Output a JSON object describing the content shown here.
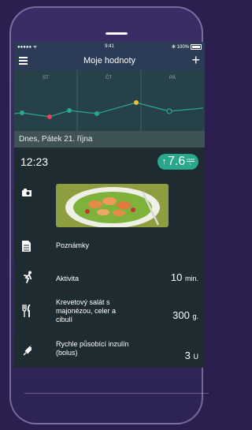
{
  "status": {
    "carrier": "●●●●● ᯤ",
    "time": "9:41",
    "battery": "✻ 100%"
  },
  "nav": {
    "title": "Moje hodnoty"
  },
  "chart": {
    "days": [
      "ST",
      "ČT",
      "PÁ"
    ]
  },
  "entry": {
    "date": "Dnes, Pátek 21. října",
    "time": "12:23",
    "glucose": {
      "arrow": "↑",
      "value": "7.6",
      "unit_top": "mmol",
      "unit_bottom": "L"
    },
    "notes_label": "Poznámky",
    "activity": {
      "label": "Aktivita",
      "value": "10",
      "unit": "min."
    },
    "meal": {
      "label": "Krevetový salát s majonézou, celer a cibulí",
      "value": "300",
      "unit": "g."
    },
    "insulin": {
      "label": "Rychle působící inzulín (bolus)",
      "value": "3",
      "unit": "U"
    }
  },
  "colors": {
    "accent": "#2aa88d",
    "red": "#e64359",
    "yellow": "#f2c12e"
  }
}
